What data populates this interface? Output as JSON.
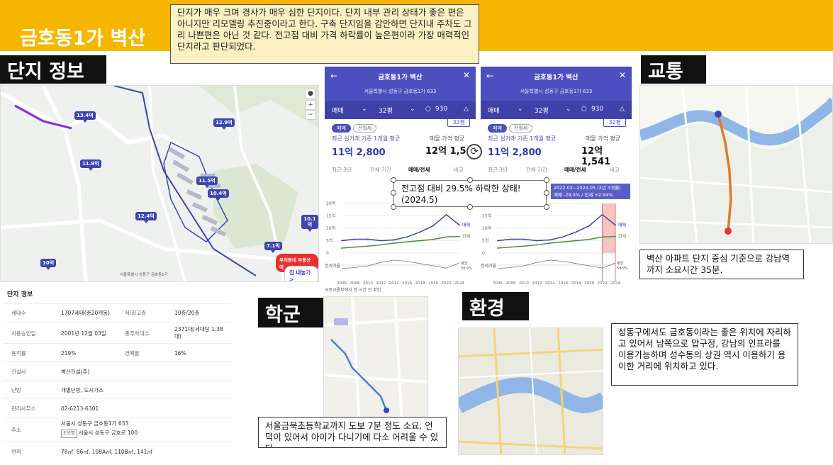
{
  "header": {
    "title": "금호동1가 벽산",
    "summary": "단지가 매우 크며 경사가 매우 심한 단지이다. 단지 내부 관리 상태가 좋은 편은 아니지만 리모델링 추진중이라고 한다. 구축 단지임을 감안하면 단지내 주차도 그리 나쁜편은 아닌 것 같다. 전고점 대비 가격 하락률이 높은편이라 가장 매력적인 단지라고 판단되었다."
  },
  "sections": {
    "complex_info": "단지 정보",
    "transport": "교통",
    "school": "학군",
    "environment": "환경"
  },
  "map1": {
    "tags": [
      "13.4억",
      "11.9억",
      "12.9억",
      "11.5억",
      "10.4억",
      "12.4억",
      "10.1억",
      "7.1억",
      "10억"
    ],
    "nearby_pill": "우리동네 부동산에",
    "nearby_btn": "집 내놓기 >",
    "caption": "서울특별시 성동구 금호동1가"
  },
  "info_table": {
    "title": "단지 정보",
    "rows": [
      {
        "k1": "세대수",
        "v1": "1707세대(총20개동)",
        "k2": "저/최고층",
        "v2": "10층/20층"
      },
      {
        "k1": "사용승인일",
        "v1": "2001년 12월 03일",
        "k2": "총주차대수",
        "v2": "2371대(세대당 1.38대)"
      },
      {
        "k1": "용적률",
        "v1": "219%",
        "k2": "건폐율",
        "v2": "16%"
      },
      {
        "k1": "건설사",
        "v1": "벽산건설(주)",
        "k2": "",
        "v2": ""
      },
      {
        "k1": "난방",
        "v1": "개별난방, 도시가스",
        "k2": "",
        "v2": ""
      },
      {
        "k1": "관리사무소",
        "v1": "02-6213-6301",
        "k2": "",
        "v2": ""
      },
      {
        "k1": "주소",
        "v1": "서울시 성동구 금호동1가 633",
        "k2": "",
        "v2": ""
      },
      {
        "k1": "면적",
        "v1": "78㎡, 86㎡, 108A㎡, 110B㎡, 141㎡",
        "k2": "",
        "v2": ""
      }
    ],
    "road_tag": "도로명",
    "road_addr": "서울시 성동구 금호로 100"
  },
  "app": {
    "title": "금호동1가 벽산",
    "address": "서울특별시 성동구 금호동1가 633",
    "trade": "매매",
    "size": "32평",
    "comments": "930",
    "pill_sale": "매매",
    "pill_rent": "전월세",
    "recent_label": "최근 실거래 기준 1개월 평균",
    "recent_value": "11억 2,800",
    "sale_label": "매물 가격 평균",
    "sale_value_left": "12억 1,54",
    "sale_value_right": "12억 1,541",
    "tabs": [
      "최근 3년",
      "전체 기간",
      "매매/전세",
      "비교"
    ],
    "y_ticks": [
      "20억",
      "15억",
      "10억",
      "5억",
      "0"
    ],
    "x_ticks": [
      "2006",
      "2008",
      "2010",
      "2012",
      "2014",
      "2016",
      "2018",
      "2020",
      "2022",
      "2024"
    ],
    "legend_sale": "매매",
    "legend_rent": "전세",
    "rate_label": "전세가율",
    "avg_label": "평균",
    "avg_value": "59.9%",
    "source": "국토교통부에서 한 시간 전 확인",
    "tooltip_line1": "2022.02~2024.05 (2년 3개월)",
    "tooltip_line2": "매매 -29.5% / 전세 +2.94%"
  },
  "overlay": {
    "text": "전고점 대비 29.5% 하락한 상태! (2024.5)"
  },
  "transport_text": "벽산 아파트 단지 중심 기준으로 강남역 까지 소요시간 35분.",
  "school_text": "서울금북초등학교까지 도보 7분 정도 소요. 언덕이 있어서 아이가 다니기에 다소 어려울 수 있다.",
  "environment_text": "성동구에서도 금호동이라는 좋은 위치에 자리하고 있어서 남쪽으로 압구정, 강남의 인프라를 이용가능하며 성수동의 상권 역시 이용하기 용이한 거리에 위치하고 있다.",
  "chart_data": {
    "type": "line",
    "x": [
      2006,
      2008,
      2010,
      2012,
      2014,
      2016,
      2018,
      2020,
      2022,
      2024
    ],
    "series": [
      {
        "name": "매매",
        "values": [
          5.0,
          5.6,
          5.6,
          5.0,
          5.3,
          6.5,
          8.5,
          11.0,
          15.5,
          11.3
        ]
      },
      {
        "name": "전세",
        "values": [
          2.0,
          2.4,
          2.8,
          3.3,
          4.0,
          4.5,
          5.0,
          5.5,
          6.5,
          6.7
        ]
      }
    ],
    "ylim": [
      0,
      20
    ],
    "colors": {
      "sale": "#2c3ab5",
      "rent": "#3b8f3b"
    }
  }
}
